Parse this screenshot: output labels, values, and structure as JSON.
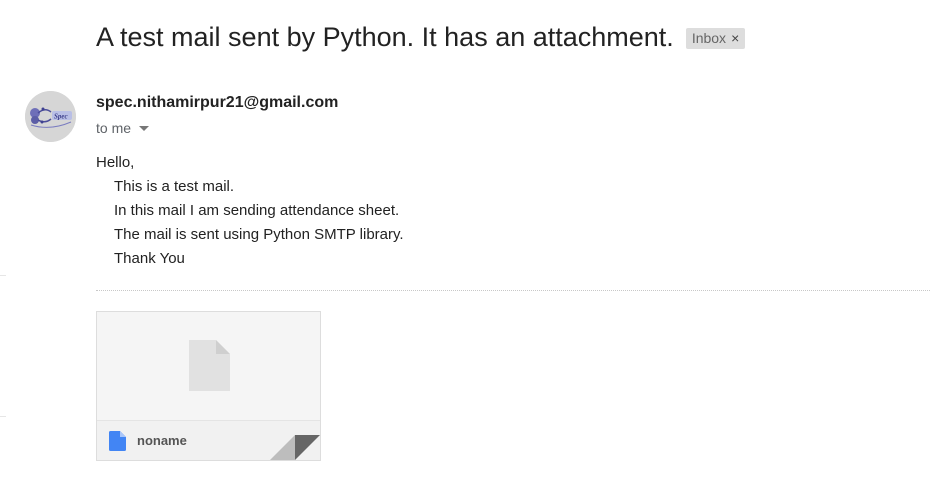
{
  "email": {
    "subject": "A test mail sent by Python. It has an attachment.",
    "label": "Inbox",
    "label_close_glyph": "×",
    "sender": "spec.nithamirpur21@gmail.com",
    "recipient": "to me",
    "body_lines": [
      "Hello,",
      "This is a test mail.",
      "In this mail I am sending attendance sheet.",
      "The mail is sent using Python SMTP library.",
      "Thank You"
    ]
  },
  "attachment": {
    "name": "noname",
    "icon": "file-icon",
    "icon_color": "#4285f4"
  },
  "colors": {
    "avatar_bg": "#d6d6d6",
    "chip_bg": "#dddddd",
    "file_icon_blue": "#4285f4"
  }
}
